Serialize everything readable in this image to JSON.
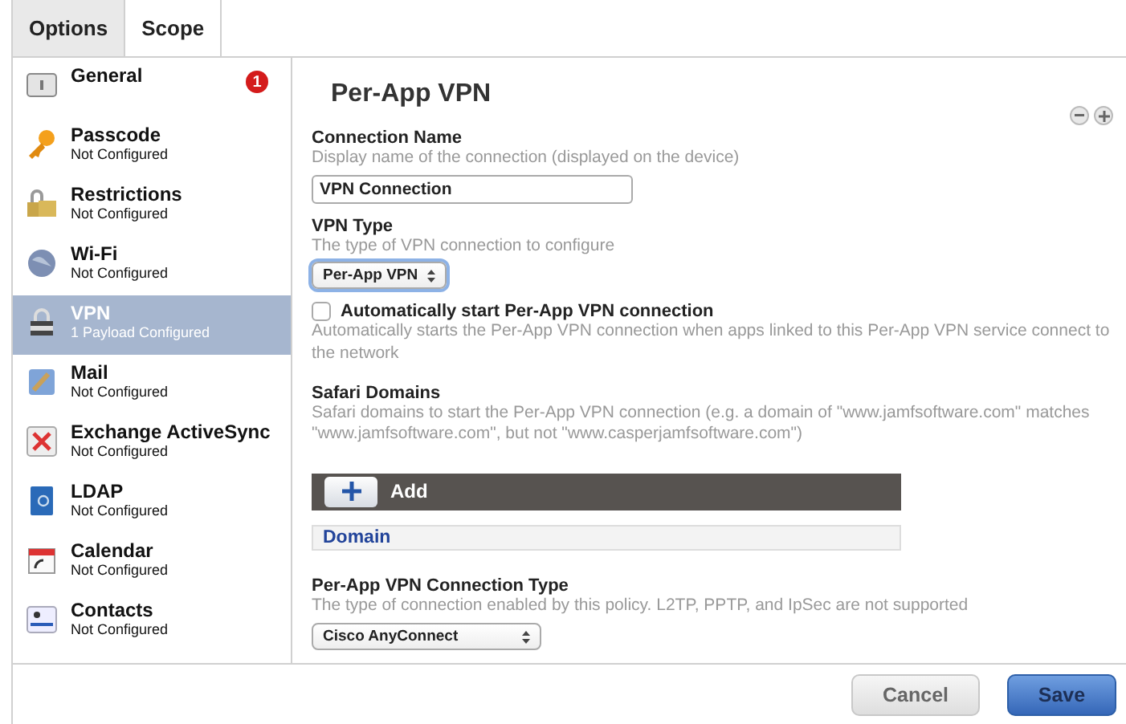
{
  "tabs": [
    {
      "label": "Options",
      "selected": true
    },
    {
      "label": "Scope",
      "selected": false
    }
  ],
  "sidebar": {
    "items": [
      {
        "title": "General",
        "badge": "1",
        "selected": false
      },
      {
        "title": "Passcode",
        "subtitle": "Not Configured",
        "selected": false
      },
      {
        "title": "Restrictions",
        "subtitle": "Not Configured",
        "selected": false
      },
      {
        "title": "Wi-Fi",
        "subtitle": "Not Configured",
        "selected": false
      },
      {
        "title": "VPN",
        "subtitle": "1 Payload Configured",
        "selected": true
      },
      {
        "title": "Mail",
        "subtitle": "Not Configured",
        "selected": false
      },
      {
        "title": "Exchange ActiveSync",
        "subtitle": "Not Configured",
        "selected": false
      },
      {
        "title": "LDAP",
        "subtitle": "Not Configured",
        "selected": false
      },
      {
        "title": "Calendar",
        "subtitle": "Not Configured",
        "selected": false
      },
      {
        "title": "Contacts",
        "subtitle": "Not Configured",
        "selected": false
      }
    ]
  },
  "main": {
    "title": "Per-App VPN",
    "connection_name": {
      "label": "Connection Name",
      "help": "Display name of the connection (displayed on the device)",
      "value": "VPN Connection"
    },
    "vpn_type": {
      "label": "VPN Type",
      "help": "The type of VPN connection to configure",
      "value": "Per-App VPN"
    },
    "auto_start": {
      "label": "Automatically start Per-App VPN connection",
      "checked": false,
      "help": "Automatically starts the Per-App VPN connection when apps linked to this Per-App VPN service connect to the network"
    },
    "safari_domains": {
      "label": "Safari Domains",
      "help": "Safari domains to start the Per-App VPN connection (e.g. a domain of \"www.jamfsoftware.com\" matches \"www.jamfsoftware.com\", but not \"www.casperjamfsoftware.com\")",
      "add_button": "Add",
      "column": "Domain"
    },
    "connection_type": {
      "label": "Per-App VPN Connection Type",
      "help": "The type of connection enabled by this policy. L2TP, PPTP, and IpSec are not supported",
      "value": "Cisco AnyConnect"
    }
  },
  "footer": {
    "buttons": [
      {
        "label": "Cancel",
        "kind": "secondary"
      },
      {
        "label": "Save",
        "kind": "primary"
      }
    ]
  }
}
